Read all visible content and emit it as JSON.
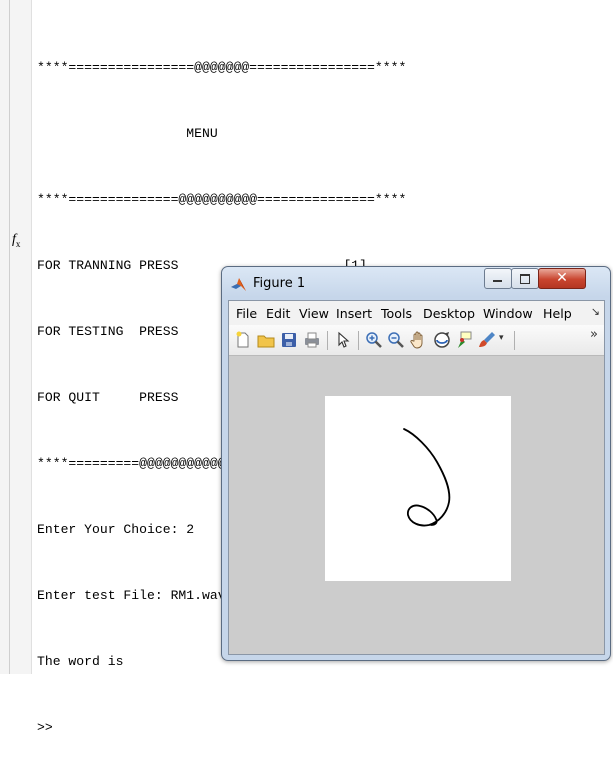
{
  "console": {
    "lines": [
      "****================@@@@@@@================****",
      "                   MENU",
      "****==============@@@@@@@@@@===============****",
      "FOR TRANNING PRESS                     [1]",
      "FOR TESTING  PRESS                     [2]",
      "FOR QUIT     PRESS                     [3]",
      "****=========@@@@@@@@@@@@@@===============****",
      "Enter Your Choice: 2",
      "Enter test File: RM1.wav",
      "The word is",
      ">>"
    ],
    "prompt_icon": "fx-icon"
  },
  "figure": {
    "title": "Figure 1",
    "menu": [
      "File",
      "Edit",
      "View",
      "Insert",
      "Tools",
      "Desktop",
      "Window",
      "Help"
    ],
    "toolbar_icons": [
      "new-figure-icon",
      "open-file-icon",
      "save-icon",
      "print-icon",
      "edit-plot-arrow-icon",
      "zoom-in-icon",
      "zoom-out-icon",
      "pan-hand-icon",
      "rotate-3d-icon",
      "data-cursor-icon",
      "brush-icon",
      "more-chevron-icon"
    ],
    "colors": {
      "titlebar": "#c6d6ea",
      "plot_bg": "#cccccc",
      "axes_bg": "#ffffff",
      "close": "#c9452f",
      "stroke": "#000000"
    }
  }
}
